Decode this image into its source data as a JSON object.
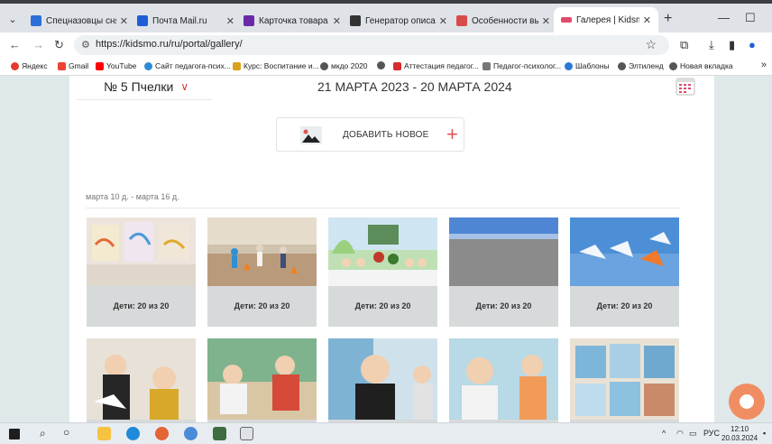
{
  "browser": {
    "tabs": [
      {
        "title": "Спецназовцы снял",
        "close": "✕",
        "color": "#2d6fd8"
      },
      {
        "title": "Почта Mail.ru",
        "close": "✕",
        "color": "#1f5fd6"
      },
      {
        "title": "Карточка товара",
        "close": "✕",
        "color": "#6a2aa8"
      },
      {
        "title": "Генератор описани",
        "close": "✕",
        "color": "#333333"
      },
      {
        "title": "Особенности выбор",
        "close": "✕",
        "color": "#d84b4b"
      },
      {
        "title": "Галерея | Kidsmo",
        "close": "✕",
        "color": "#e24a6a",
        "active": true
      }
    ],
    "new_tab": "+",
    "window_controls": {
      "minimize": "—",
      "maximize": "☐"
    },
    "url": "https://kidsmo.ru/ru/portal/gallery/",
    "bookmarks": [
      {
        "label": "Яндекс",
        "color": "#e53b2c"
      },
      {
        "label": "Gmail",
        "color": "#ea4335"
      },
      {
        "label": "YouTube",
        "color": "#ff0000"
      },
      {
        "label": "Сайт педагога-псих...",
        "color": "#2a8bd6"
      },
      {
        "label": "Курс: Воспитание и...",
        "color": "#d9a21b"
      },
      {
        "label": "мкдо 2020",
        "color": "#555555"
      },
      {
        "label": "Аттестация педагог...",
        "color": "#d92b2b"
      },
      {
        "label": "Педагог-психолог...",
        "color": "#777777"
      },
      {
        "label": "Шаблоны",
        "color": "#2a79d6"
      },
      {
        "label": "Элтиленд",
        "color": "#555555"
      },
      {
        "label": "Новая вкладка",
        "color": "#555555"
      }
    ],
    "bookmarks_more": "»"
  },
  "page": {
    "group": "№ 5 Пчелки",
    "date_range": "21 МАРТА 2023 - 20 МАРТА 2024",
    "add_button": "ДОБАВИТЬ НОВОЕ",
    "week_label": "марта 10 д. - марта 16 д.",
    "row1": [
      {
        "caption": "Дети: 20 из 20"
      },
      {
        "caption": "Дети: 20 из 20"
      },
      {
        "caption": "Дети: 20 из 20"
      },
      {
        "caption": "Дети: 20 из 20"
      },
      {
        "caption": "Дети: 20 из 20"
      }
    ]
  },
  "taskbar": {
    "language": "РУС",
    "time": "12:10",
    "date": "20.03.2024"
  }
}
